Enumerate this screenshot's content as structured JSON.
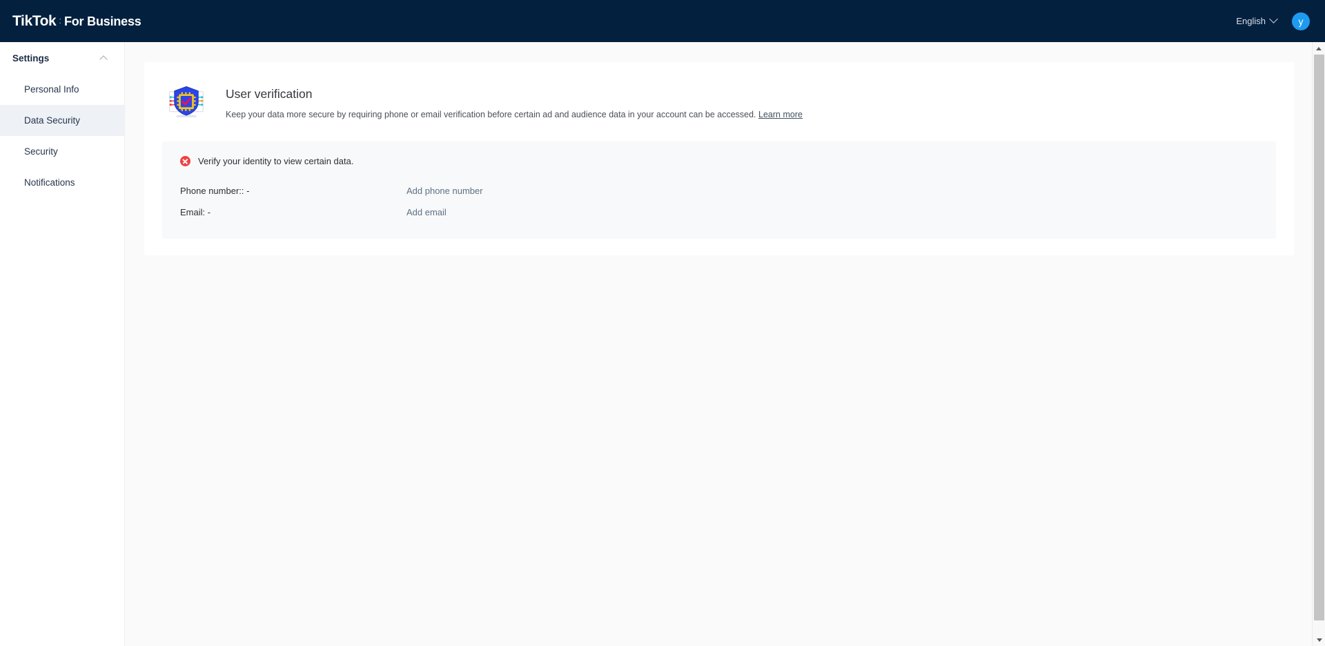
{
  "topbar": {
    "brand_primary": "TikTok",
    "brand_separator": ":",
    "brand_secondary": "For Business",
    "language_label": "English",
    "language_chevron_icon": "chevron-down-icon",
    "avatar_initial": "y",
    "avatar_color": "#1d9bf0",
    "background_color": "#04203f"
  },
  "sidebar": {
    "title": "Settings",
    "collapse_icon": "chevron-up-icon",
    "items": [
      {
        "label": "Personal Info",
        "active": false
      },
      {
        "label": "Data Security",
        "active": true
      },
      {
        "label": "Security",
        "active": false
      },
      {
        "label": "Notifications",
        "active": false
      }
    ],
    "active_background": "#eef1f6"
  },
  "main": {
    "card": {
      "icon_name": "shield-verification-icon",
      "title": "User verification",
      "description": "Keep your data more secure by requiring phone or email verification before certain ad and audience data in your account can be accessed.",
      "learn_more_label": "Learn more"
    },
    "panel": {
      "alert_icon": "error-circle-icon",
      "alert_text": "Verify your identity to view certain data.",
      "alert_color": "#f04142",
      "rows": [
        {
          "label": "Phone number:: -",
          "action": "Add phone number"
        },
        {
          "label": "Email: -",
          "action": "Add email"
        }
      ],
      "link_color": "#5d7085"
    }
  },
  "scrollbar": {
    "up_icon": "scroll-up-arrow-icon",
    "down_icon": "scroll-down-arrow-icon"
  }
}
